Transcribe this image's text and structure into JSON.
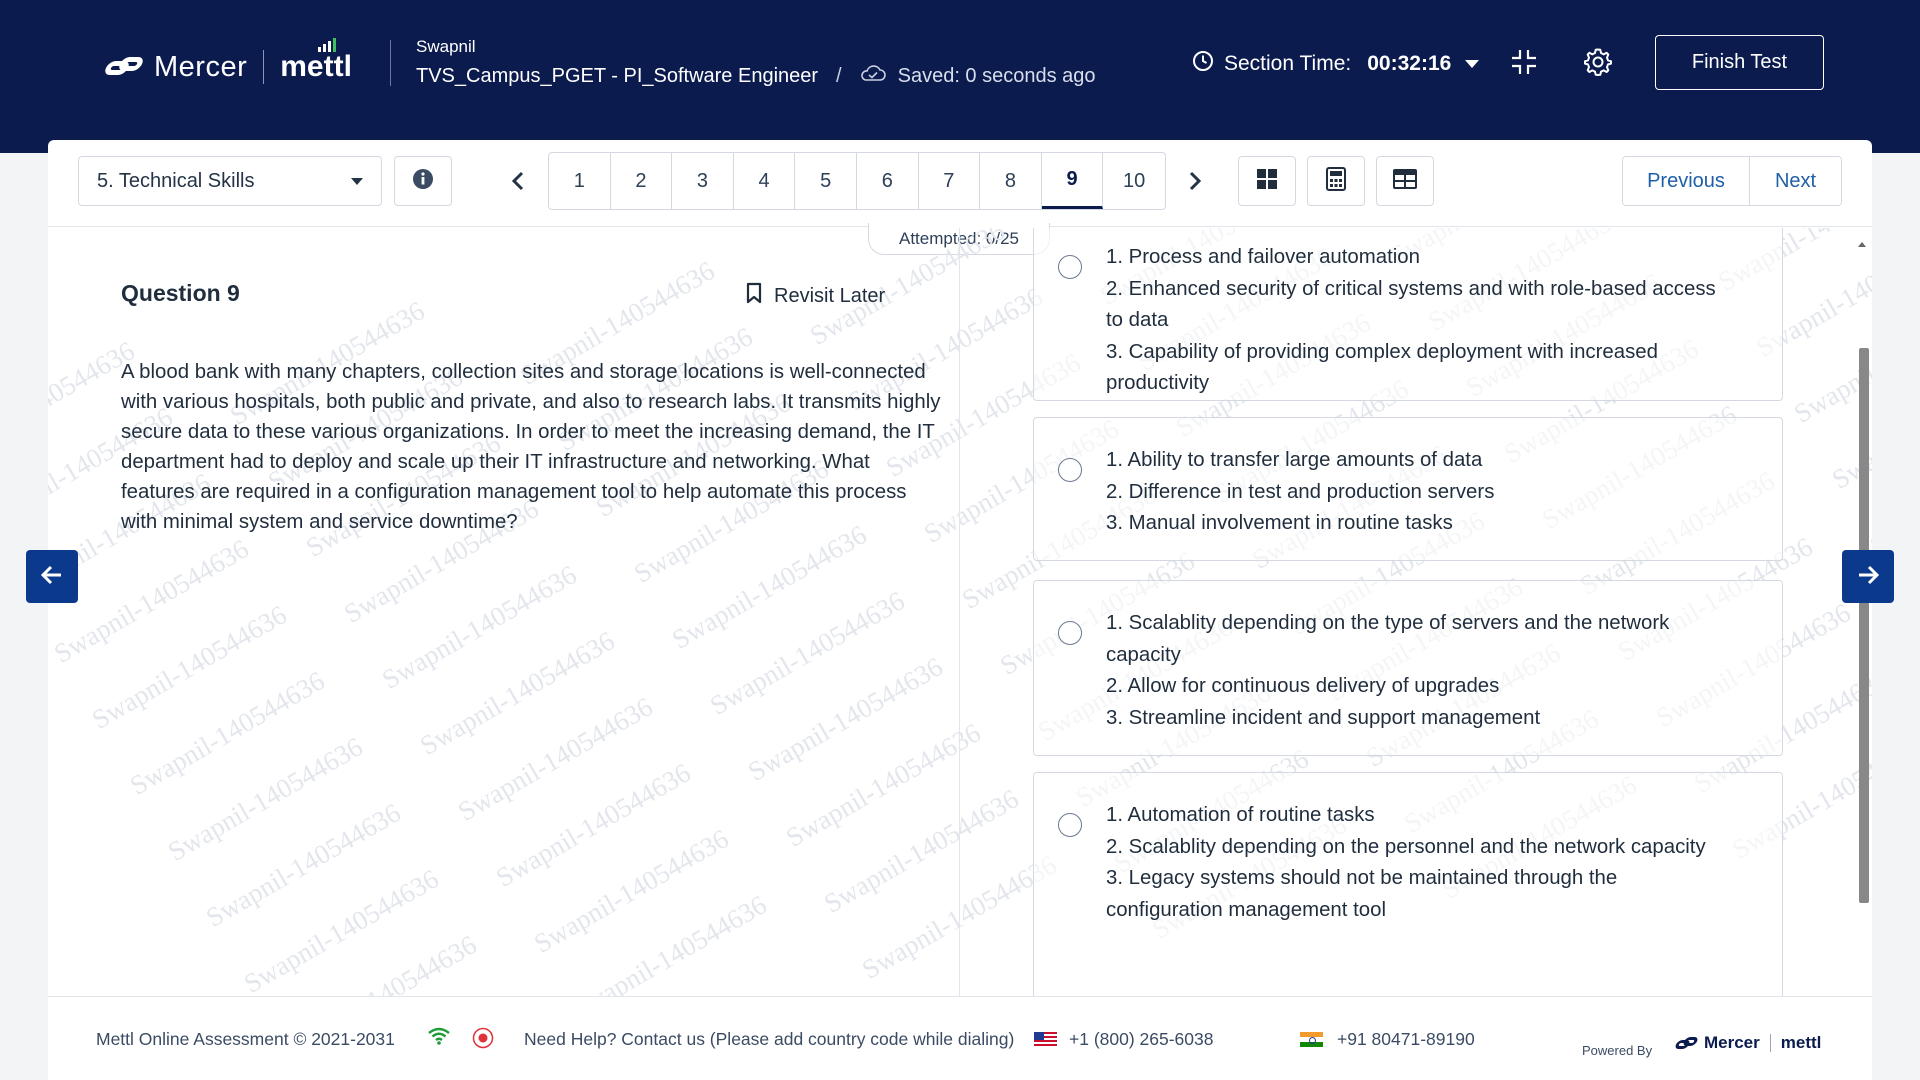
{
  "header": {
    "brand_mercer": "Mercer",
    "brand_mettl": "mettl",
    "user_name": "Swapnil",
    "test_name": "TVS_Campus_PGET - PI_Software Engineer",
    "separator": "/",
    "saved_status": "Saved: 0 seconds ago",
    "section_time_label": "Section Time:",
    "section_time_value": "00:32:16",
    "finish_label": "Finish Test"
  },
  "toolbar": {
    "section_selected": "5. Technical Skills",
    "pages": [
      "1",
      "2",
      "3",
      "4",
      "5",
      "6",
      "7",
      "8",
      "9",
      "10"
    ],
    "active_page": "9",
    "attempted": "Attempted: 0/25",
    "previous_label": "Previous",
    "next_label": "Next"
  },
  "question": {
    "title": "Question 9",
    "revisit_label": "Revisit Later",
    "text": "A blood bank with many chapters, collection sites and storage locations is well-connected with various hospitals, both public and private, and also to research labs. It transmits highly secure data to these various organizations. In order to meet the increasing demand, the IT department had to deploy and scale up their IT infrastructure and networking. What features are required in a configuration management tool to help automate this process with minimal system and service downtime?"
  },
  "options": [
    {
      "lines": [
        "1. Process and failover automation",
        "2. Enhanced security of critical systems and with role-based access to data",
        "3. Capability of providing complex deployment with increased productivity"
      ]
    },
    {
      "lines": [
        "1. Ability to transfer large amounts of data",
        "2. Difference in test and production servers",
        "3. Manual involvement in routine tasks"
      ]
    },
    {
      "lines": [
        "1. Scalablity depending on the type of servers and the network capacity",
        "2. Allow for continuous delivery of upgrades",
        "3. Streamline incident and support management"
      ]
    },
    {
      "lines": [
        "1. Automation of routine tasks",
        "2. Scalablity depending on the personnel and the network capacity",
        "3. Legacy systems should not be maintained through the configuration management tool"
      ]
    }
  ],
  "watermark_text": "Swapnil-140544636",
  "footer": {
    "copyright": "Mettl Online Assessment © 2021-2031",
    "help_text": "Need Help? Contact us (Please add country code while dialing)",
    "phone_us": "+1 (800) 265-6038",
    "phone_in": "+91 80471-89190",
    "powered_by": "Powered By",
    "brand_mercer": "Mercer",
    "brand_mettl": "mettl"
  },
  "colors": {
    "header_bg": "#0b1b4d",
    "accent": "#0b3a8c",
    "link": "#1f5fa8",
    "wifi": "#1e9e3a",
    "record": "#e0303a"
  },
  "icons": [
    "clock-icon",
    "cloud-icon",
    "collapse-icon",
    "gear-icon",
    "info-icon",
    "grid-view-icon",
    "calculator-icon",
    "table-icon",
    "bookmark-icon",
    "wifi-icon",
    "record-icon",
    "arrow-left-icon",
    "arrow-right-icon"
  ]
}
